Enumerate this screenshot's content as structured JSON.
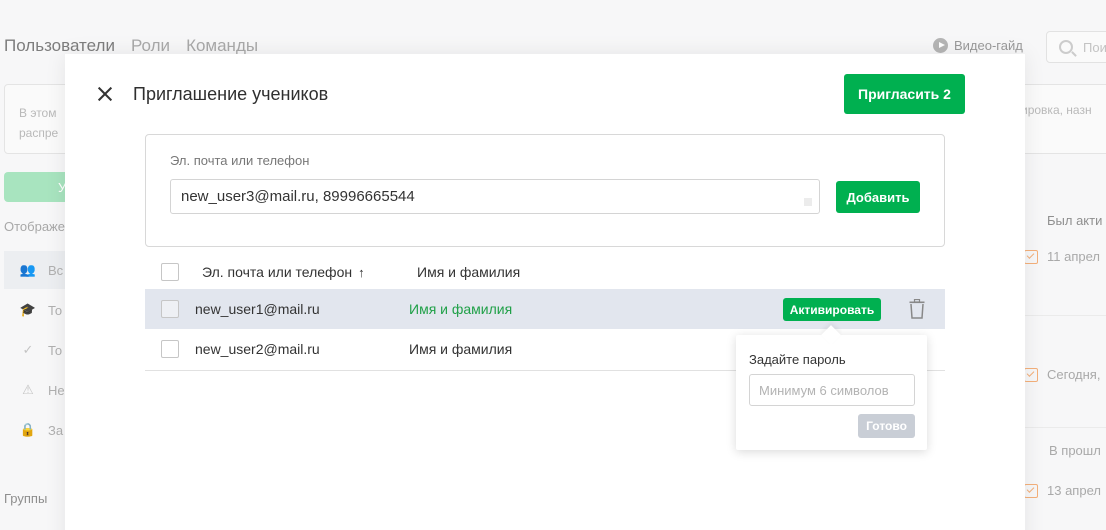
{
  "background": {
    "tabs": [
      "Пользователи",
      "Роли",
      "Команды"
    ],
    "video_guide_label": "Видео-гайд",
    "search_placeholder": "Пои",
    "info_text": [
      "В этом",
      "распре"
    ],
    "info_text_right": "ировка, назн",
    "create_button_partial": "У",
    "display_label": "Отображе",
    "sidebar_items": [
      {
        "label": "Вс",
        "icon": "users-icon"
      },
      {
        "label": "То",
        "icon": "graduation-cap-icon"
      },
      {
        "label": "То",
        "icon": "check-icon"
      },
      {
        "label": "Не",
        "icon": "warning-icon"
      },
      {
        "label": "За",
        "icon": "lock-icon"
      }
    ],
    "groups_label": "Группы",
    "last_active_header": "Был акти",
    "rows": [
      "11 апрел",
      "Сегодня,",
      "В прошл",
      "13 апрел"
    ]
  },
  "modal": {
    "title": "Приглашение учеников",
    "invite_button": "Пригласить 2",
    "form": {
      "label": "Эл. почта или телефон",
      "input_value": "new_user3@mail.ru, 89996665544",
      "add_button": "Добавить"
    },
    "table": {
      "columns": {
        "contact": "Эл. почта или телефон",
        "sort_arrow": "↑",
        "name": "Имя и фамилия"
      },
      "rows": [
        {
          "contact": "new_user1@mail.ru",
          "name": "Имя и фамилия",
          "action": "Активировать"
        },
        {
          "contact": "new_user2@mail.ru",
          "name": "Имя и фамилия"
        }
      ]
    },
    "password_popover": {
      "label": "Задайте пароль",
      "placeholder": "Минимум 6 символов",
      "done_button": "Готово"
    }
  },
  "colors": {
    "primary_green": "#00b050",
    "name_green": "#20a048",
    "selected_row": "#e2e6ee",
    "disabled_button": "#c9ced6"
  }
}
